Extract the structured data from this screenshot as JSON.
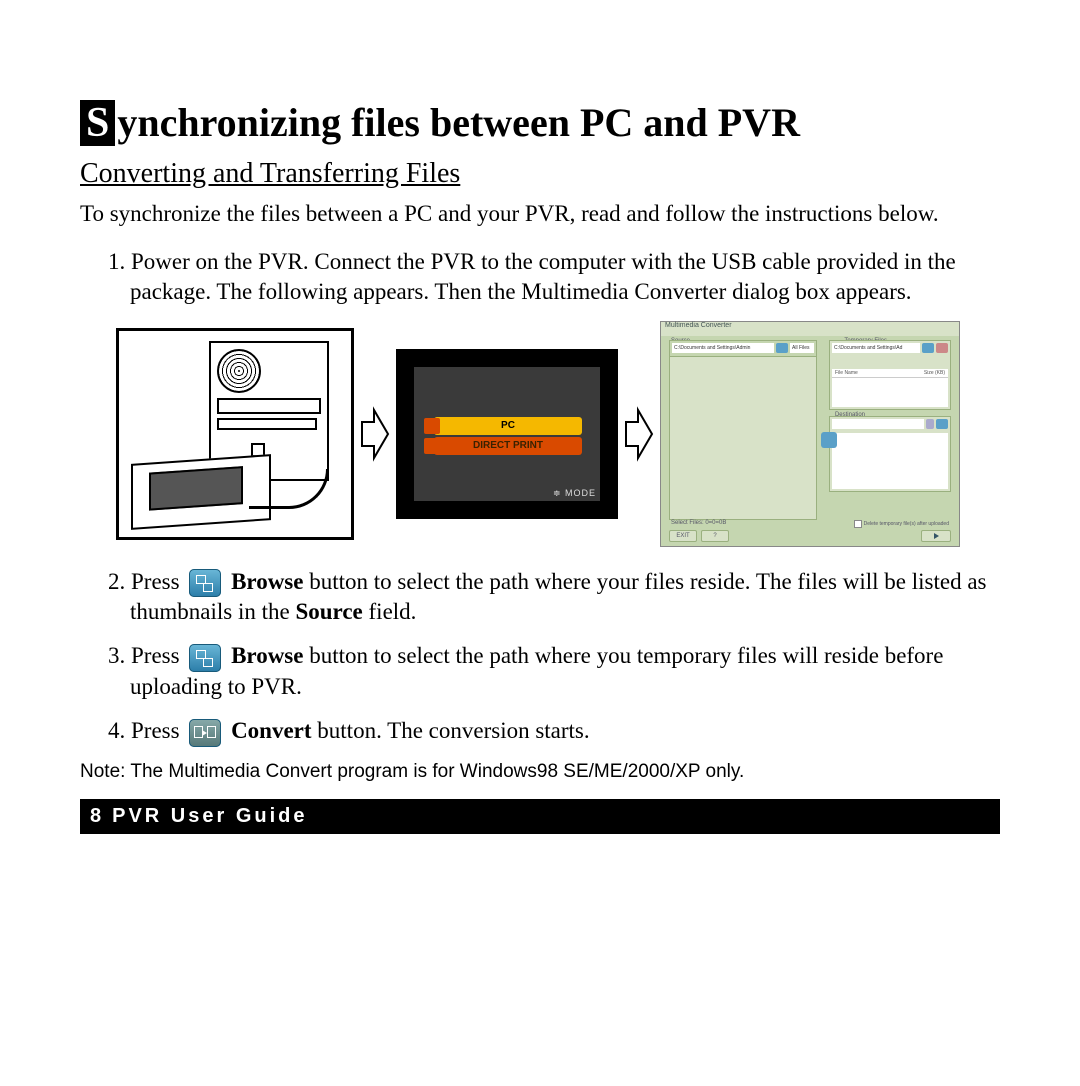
{
  "heading": {
    "dropcap": "S",
    "rest": "ynchronizing files between PC and PVR"
  },
  "subtitle": "Converting and Transferring Files",
  "intro": "To synchronize the files between  a PC and your PVR, read and follow the instructions below.",
  "steps": {
    "s1": {
      "num": "1.",
      "text": "Power on the PVR. Connect the PVR to the computer with the USB cable provided in the package. The following appears. Then the Multimedia Converter dialog box appears."
    },
    "s2": {
      "num": "2.",
      "pre": "Press",
      "bold": "Browse",
      "post1": " button to select the path where your files reside. The files will be listed as thumbnails in the ",
      "bold2": "Source",
      "post2": " field."
    },
    "s3": {
      "num": "3.",
      "pre": "Press",
      "bold": "Browse",
      "post": " button to select the path where you temporary files will reside before uploading to PVR."
    },
    "s4": {
      "num": "4.",
      "pre": "Press",
      "bold": "Convert",
      "post": " button. The conversion starts."
    }
  },
  "pvr_menu": {
    "pc": "PC",
    "direct_print": "DIRECT PRINT",
    "mode": "≑ MODE"
  },
  "converter": {
    "window_title": "Multimedia Converter",
    "source_label": "Source",
    "source_path": "C:\\Documents and Settings\\Admin",
    "source_filter": "All Files",
    "temp_label": "Temporary Files",
    "temp_path": "C:\\Documents and Settings\\Ad",
    "col_name": "File Name",
    "col_size": "Size (KB)",
    "dest_label": "Destination",
    "select_label": "Select Files: 0=0=0B",
    "exit": "EXIT",
    "help": "?",
    "delete_check": "Delete temporary file(s) after uploaded"
  },
  "note": "Note: The Multimedia Convert program is for Windows98 SE/ME/2000/XP only.",
  "footer": {
    "page": "8",
    "title": "PVR User Guide"
  }
}
